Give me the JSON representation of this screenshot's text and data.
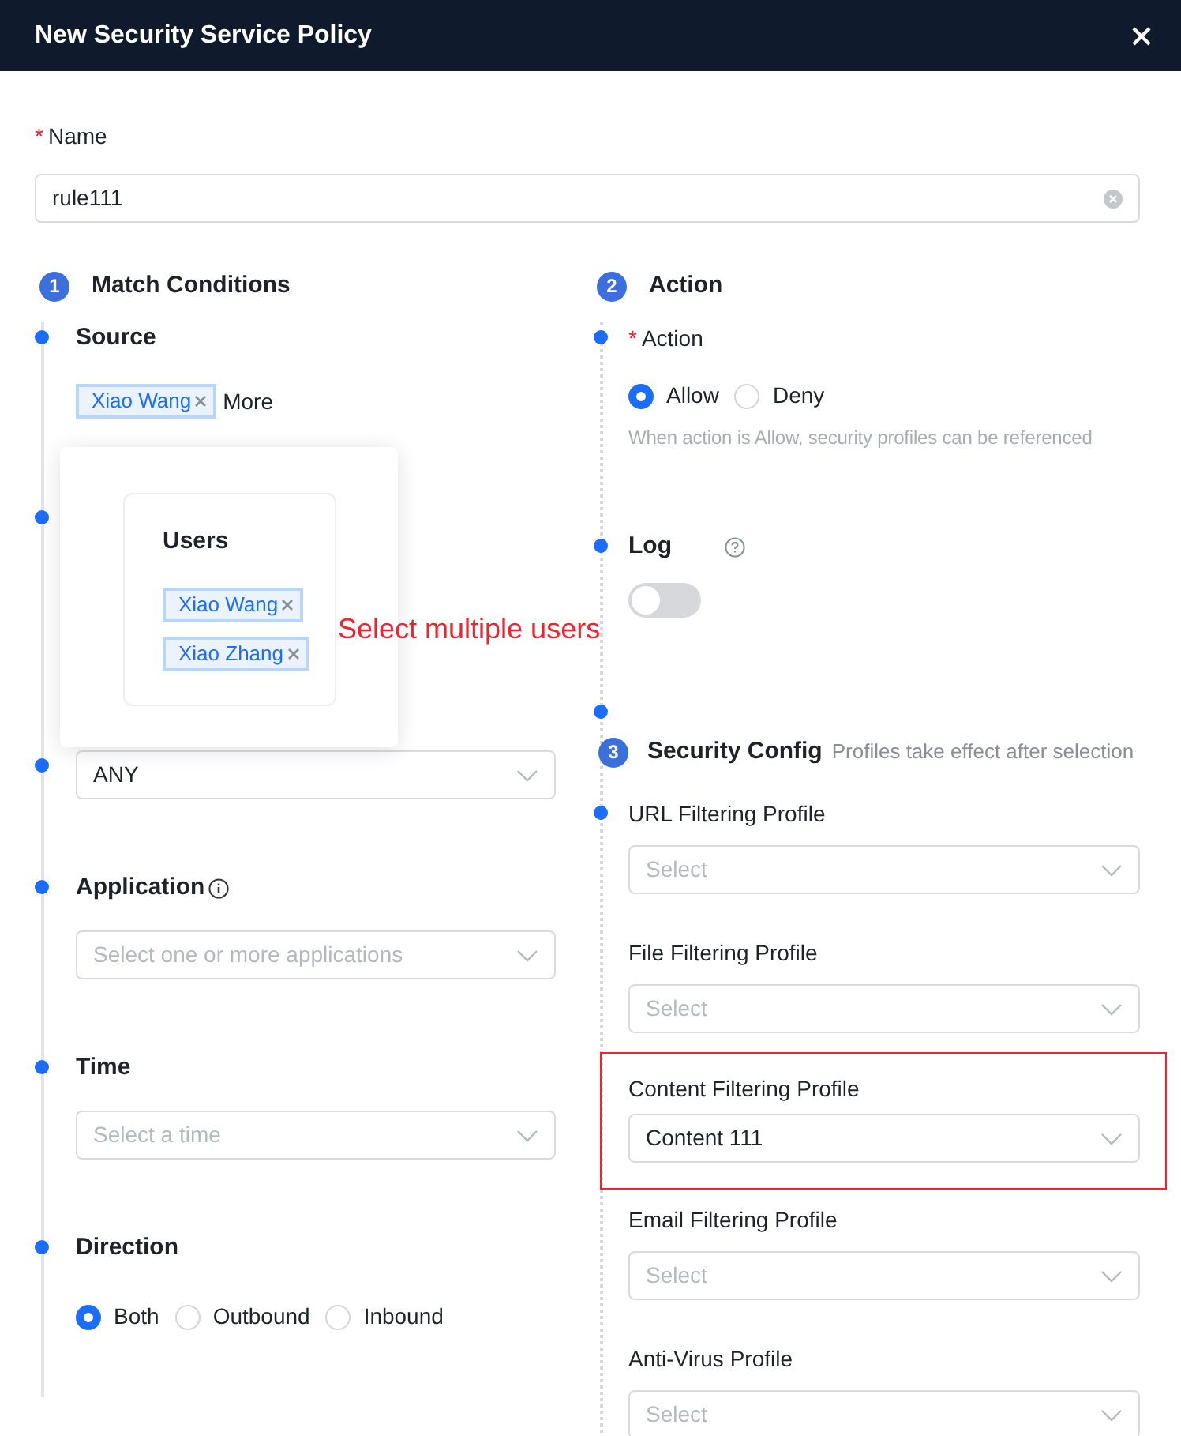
{
  "dialog": {
    "title": "New Security Service Policy"
  },
  "name_field": {
    "required_mark": "*",
    "label": "Name",
    "value": "rule111"
  },
  "columns": [
    {
      "step": "1",
      "title": "Match Conditions",
      "dotted": false,
      "items": [
        {
          "kind": "tags",
          "title": "Source",
          "dot": true,
          "tags": [
            "Xiao Wang"
          ],
          "more": "More"
        },
        {
          "kind": "covered",
          "dot": true
        },
        {
          "kind": "select",
          "dot": true,
          "value": "ANY"
        },
        {
          "kind": "select",
          "title": "Application",
          "info": true,
          "dot": true,
          "placeholder": "Select one or more applications"
        },
        {
          "kind": "select",
          "title": "Time",
          "dot": true,
          "placeholder": "Select a time"
        },
        {
          "kind": "radios",
          "title": "Direction",
          "dot": true,
          "options": [
            {
              "label": "Both",
              "selected": true
            },
            {
              "label": "Outbound",
              "selected": false
            },
            {
              "label": "Inbound",
              "selected": false
            }
          ]
        }
      ]
    },
    {
      "step": "2",
      "title": "Action",
      "dotted": true,
      "items": [
        {
          "kind": "radios",
          "required_mark": "*",
          "label": "Action",
          "dot": true,
          "options": [
            {
              "label": "Allow",
              "selected": true
            },
            {
              "label": "Deny",
              "selected": false
            }
          ],
          "hint": "When action is Allow, security profiles can be referenced"
        },
        {
          "kind": "toggle",
          "title": "Log",
          "help": true,
          "dot": true,
          "on": false
        },
        {
          "kind": "blank",
          "dot": true
        },
        {
          "kind": "step",
          "step": "3",
          "heading": "Security Config",
          "note": "Profiles take effect after selection"
        },
        {
          "kind": "select",
          "label": "URL Filtering Profile",
          "dot": true,
          "placeholder": "Select"
        },
        {
          "kind": "select",
          "label": "File Filtering Profile",
          "placeholder": "Select"
        },
        {
          "kind": "select",
          "label": "Content Filtering Profile",
          "highlighted": true,
          "value": "Content 111"
        },
        {
          "kind": "select",
          "label": "Email Filtering Profile",
          "placeholder": "Select"
        },
        {
          "kind": "select",
          "label": "Anti-Virus Profile",
          "placeholder": "Select"
        }
      ]
    }
  ],
  "popup": {
    "title": "Users",
    "tags": [
      "Xiao Wang",
      "Xiao Zhang"
    ]
  },
  "annotation": "Select multiple users"
}
